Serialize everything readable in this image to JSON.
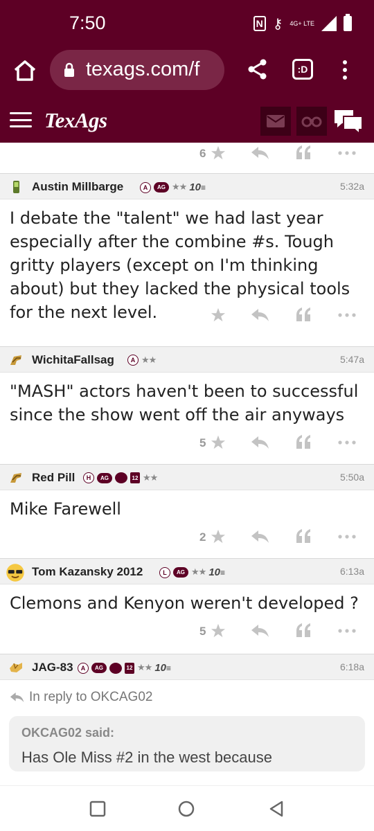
{
  "status_bar": {
    "time": "7:50",
    "network": "4G+ LTE"
  },
  "browser": {
    "url": "texags.com/f",
    "tabs_label": ":D"
  },
  "site": {
    "logo": "TexAgs"
  },
  "top_actions": {
    "star_count": "6"
  },
  "posts": [
    {
      "username": "Austin Millbarge",
      "badges": [
        "A",
        "AG",
        "★★",
        "10"
      ],
      "timestamp": "5:32a",
      "body": "I debate the \"talent\" we had last year especially after the combine #s. Tough gritty players (except on I'm thinking about) but they lacked the physical tools for the next level.",
      "star_count": ""
    },
    {
      "username": "WichitaFallsag",
      "badges": [
        "A",
        "★★"
      ],
      "timestamp": "5:47a",
      "body": "\"MASH\" actors haven't been to successful since the show went off the air anyways",
      "star_count": "5"
    },
    {
      "username": "Red Pill",
      "badges": [
        "H",
        "AG",
        "12",
        "★★"
      ],
      "timestamp": "5:50a",
      "body": "Mike Farewell",
      "star_count": "2"
    },
    {
      "username": "Tom Kazansky 2012",
      "badges": [
        "L",
        "AG",
        "★★",
        "10"
      ],
      "timestamp": "6:13a",
      "body": "Clemons and Kenyon weren't developed ?",
      "star_count": "5"
    },
    {
      "username": "JAG-83",
      "badges": [
        "A",
        "AG",
        "12",
        "★★",
        "10"
      ],
      "timestamp": "6:18a",
      "reply_to": "In reply to OKCAG02",
      "quote_author": "OKCAG02 said:",
      "quote_text": "Has Ole Miss #2 in the west because"
    }
  ],
  "colors": {
    "maroon": "#5d0025",
    "icon_gray": "#b5b5b5"
  }
}
